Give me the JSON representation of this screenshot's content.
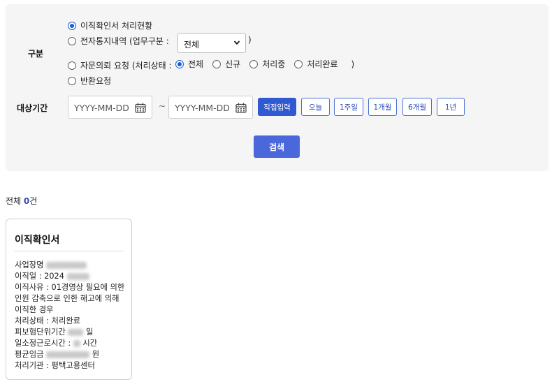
{
  "filter": {
    "category_label": "구분",
    "options": [
      {
        "label": "이직확인서 처리현황",
        "checked": true
      },
      {
        "label": "전자통지내역 (업무구분 :",
        "checked": false
      },
      {
        "label": "자문의뢰 요청 (처리상태 :",
        "checked": false
      },
      {
        "label": "반환요청",
        "checked": false
      }
    ],
    "work_type_select": "전체",
    "close_paren": ")",
    "status_options": [
      {
        "label": "전체",
        "checked": true
      },
      {
        "label": "신규",
        "checked": false
      },
      {
        "label": "처리중",
        "checked": false
      },
      {
        "label": "처리완료",
        "checked": false
      }
    ],
    "period_label": "대상기간",
    "start_placeholder": "YYYY-MM-DD",
    "end_placeholder": "YYYY-MM-DD",
    "tilde": "~",
    "direct_input": "직접입력",
    "period_buttons": [
      "오늘",
      "1주일",
      "1개월",
      "6개월",
      "1년"
    ],
    "search_button": "검색"
  },
  "results": {
    "total_prefix": "전체 ",
    "count": "0",
    "total_suffix": "건"
  },
  "card": {
    "title": "이직확인서",
    "company_label": "사업장명",
    "leave_date_label": "이직일 : 2024",
    "reason_label": "이직사유 : 01경영상 필요에 의한 인원 감축으로 인한 해고에 의해 이직한 경우",
    "status": "처리상태 : 처리완료",
    "insured_period_label": "피보험단위기간",
    "insured_period_unit": "일",
    "hours_label": "일소정근로시간 :",
    "hours_unit": "시간",
    "wage_label": "평균임금",
    "wage_unit": "원",
    "agency": "처리기관 : 평택고용센터"
  }
}
